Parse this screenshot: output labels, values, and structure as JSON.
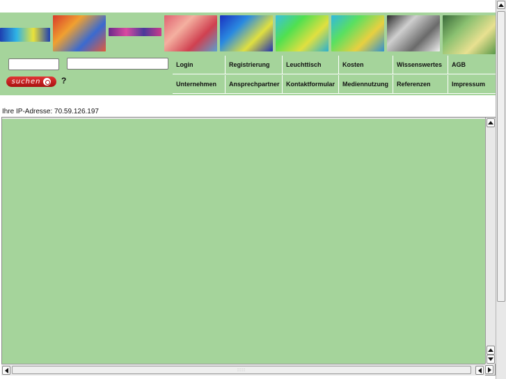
{
  "header": {
    "thumbnail_names": [
      "thermal-strip",
      "thermal-roof",
      "thermal-ribbon",
      "thermal-facade",
      "thermal-blue",
      "thermal-building",
      "thermal-aerial",
      "machine-photo",
      "roof-photo"
    ]
  },
  "search": {
    "button_label": "suchen",
    "help_label": "?"
  },
  "nav": {
    "row1": [
      "Login",
      "Registrierung",
      "Leuchttisch",
      "Kosten",
      "Wissenswertes",
      "AGB"
    ],
    "row2": [
      "Unternehmen",
      "Ansprechpartner",
      "Kontaktformular",
      "Mediennutzung",
      "Referenzen",
      "Impressum"
    ]
  },
  "ip_line": "Ihre IP-Adresse: 70.59.126.197",
  "colors": {
    "panel_green": "#a5d49b",
    "button_red": "#c81e1e"
  }
}
